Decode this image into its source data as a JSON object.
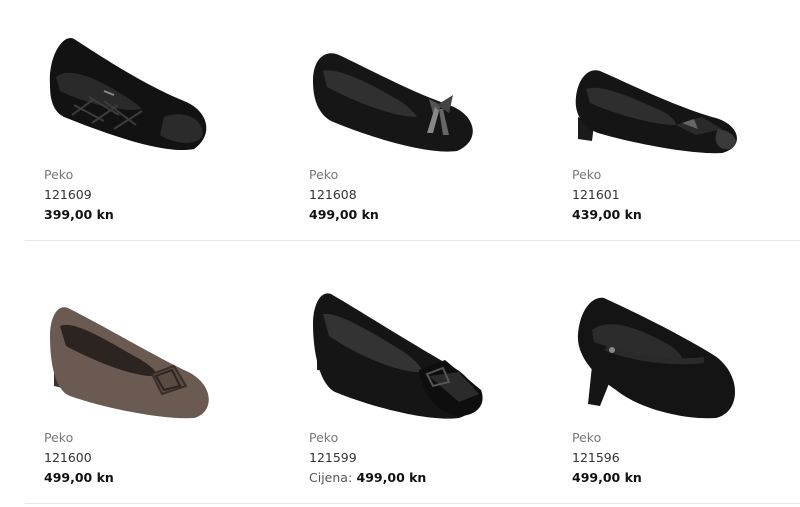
{
  "products": [
    {
      "brand": "Peko",
      "code": "121609",
      "price": "399,00 kn",
      "price_label": "",
      "image_icon": "black-quilted-ballet-flat-icon"
    },
    {
      "brand": "Peko",
      "code": "121608",
      "price": "499,00 kn",
      "price_label": "",
      "image_icon": "black-suede-bow-flat-icon"
    },
    {
      "brand": "Peko",
      "code": "121601",
      "price": "439,00 kn",
      "price_label": "",
      "image_icon": "black-low-heel-pump-icon"
    },
    {
      "brand": "Peko",
      "code": "121600",
      "price": "499,00 kn",
      "price_label": "",
      "image_icon": "brown-buckle-pump-icon"
    },
    {
      "brand": "Peko",
      "code": "121599",
      "price": "499,00 kn",
      "price_label": "Cijena:",
      "image_icon": "black-patent-toe-pump-icon"
    },
    {
      "brand": "Peko",
      "code": "121596",
      "price": "499,00 kn",
      "price_label": "",
      "image_icon": "black-mary-jane-heel-icon"
    }
  ],
  "colors": {
    "shoe_black": "#141414",
    "shoe_brown": "#6a5a52",
    "divider": "#e6e6e6"
  }
}
